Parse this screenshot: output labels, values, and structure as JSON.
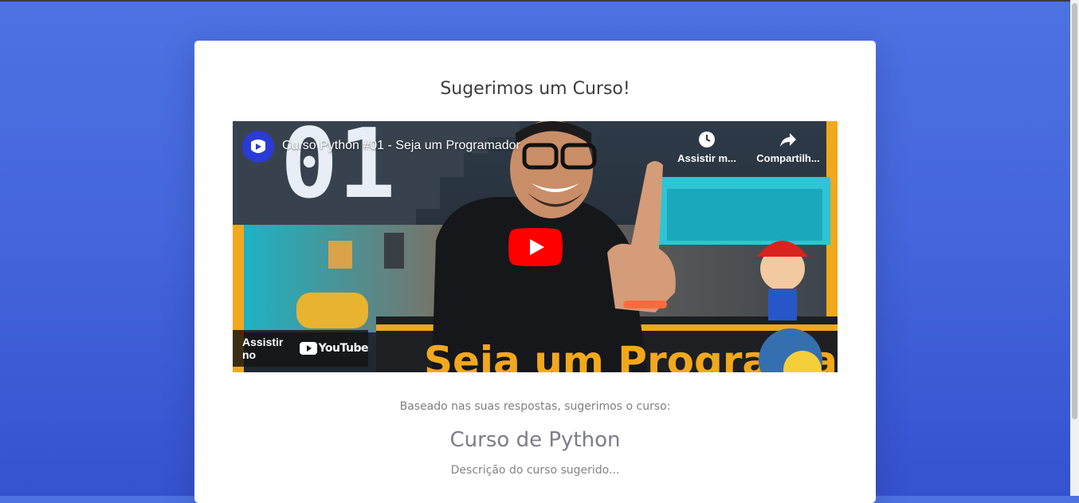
{
  "card": {
    "title": "Sugerimos um Curso!",
    "suggest_text": "Baseado nas suas respostas, sugerimos o curso:",
    "course_name": "Curso de Python",
    "course_description": "Descrição do curso sugerido..."
  },
  "video": {
    "title": "Curso Python #01 - Seja um Programador",
    "watch_later_label": "Assistir m...",
    "share_label": "Compartilh...",
    "watch_on_label": "Assistir no",
    "youtube_wordmark": "YouTube",
    "thumb_number": "01",
    "thumb_banner": "Seja um Programador"
  },
  "colors": {
    "background_top": "#4d72e2",
    "background_bottom": "#3552cf",
    "card": "#ffffff",
    "play_button": "#ff0000",
    "channel_avatar": "#2a3bd6"
  },
  "icons": [
    "channel-logo-icon",
    "clock-icon",
    "share-icon",
    "play-icon",
    "youtube-logo-icon"
  ]
}
